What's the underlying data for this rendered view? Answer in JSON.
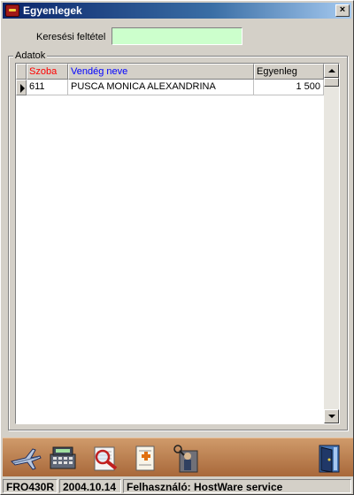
{
  "window": {
    "title": "Egyenlegek",
    "close_label": "×",
    "icon": "app-key-icon"
  },
  "search": {
    "label": "Keresési feltétel",
    "value": "",
    "placeholder": ""
  },
  "group": {
    "label": "Adatok"
  },
  "grid": {
    "columns": [
      {
        "label": "Szoba",
        "color": "#ff0000"
      },
      {
        "label": "Vendég neve",
        "color": "#0000ff"
      },
      {
        "label": "Egyenleg",
        "color": "#000000"
      }
    ],
    "rows": [
      {
        "room": "611",
        "guest": "PUSCA MONICA ALEXANDRINA",
        "balance": "1 500"
      }
    ]
  },
  "toolbar": {
    "buttons": [
      {
        "name": "airplane-icon"
      },
      {
        "name": "cash-register-icon"
      },
      {
        "name": "magnifier-icon"
      },
      {
        "name": "add-document-icon"
      },
      {
        "name": "person-search-icon"
      },
      {
        "name": "exit-door-icon"
      }
    ]
  },
  "status": {
    "code": "FRO430R",
    "date": "2004.10.14",
    "user": "Felhasználó: HostWare service"
  },
  "colors": {
    "title_bar": "#0a246a",
    "search_bg": "#ccffcc",
    "toolbar_bg": "#b87848"
  }
}
